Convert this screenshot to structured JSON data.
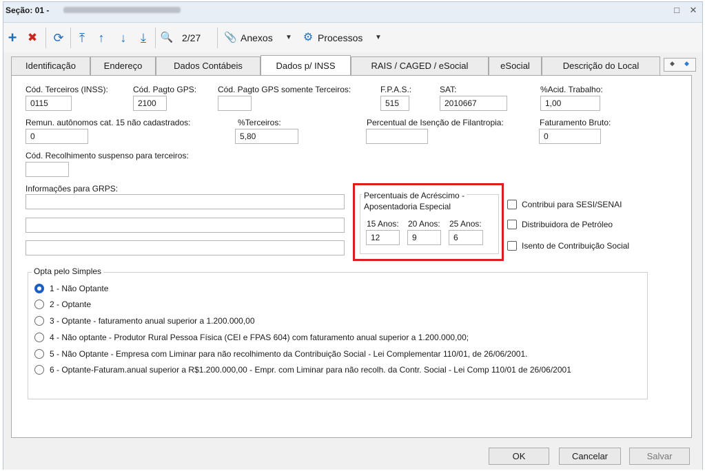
{
  "window": {
    "title": "Seção: 01 -",
    "maximize_icon": "□",
    "close_icon": "✕"
  },
  "toolbar": {
    "record_position": "2/27",
    "anexos_label": "Anexos",
    "processos_label": "Processos",
    "icons": {
      "add": "+",
      "delete": "✖",
      "refresh": "⟳",
      "first": "⤒",
      "up": "↑",
      "down": "↓",
      "last": "⤓",
      "search": "🔍",
      "attach": "📎",
      "gear": "⚙",
      "dropdown": "▼"
    },
    "colors": {
      "add": "#1f6fbf",
      "delete": "#c8281e",
      "nav": "#1f6fbf"
    }
  },
  "tabs": [
    {
      "label": "Identificação"
    },
    {
      "label": "Endereço"
    },
    {
      "label": "Dados Contábeis"
    },
    {
      "label": "Dados p/ INSS"
    },
    {
      "label": "RAIS / CAGED / eSocial"
    },
    {
      "label": "eSocial"
    },
    {
      "label": "Descrição do Local"
    }
  ],
  "active_tab": "Dados p/ INSS",
  "tab_nav": {
    "prev": "◆",
    "next": "◆"
  },
  "form": {
    "cod_terceiros": {
      "label": "Cód. Terceiros (INSS):",
      "value": "0115"
    },
    "cod_pagto_gps": {
      "label": "Cód. Pagto GPS:",
      "value": "2100"
    },
    "cod_pagto_gps_terceiros": {
      "label": "Cód. Pagto GPS somente Terceiros:",
      "value": ""
    },
    "fpas": {
      "label": "F.P.A.S.:",
      "value": "515"
    },
    "sat": {
      "label": "SAT:",
      "value": "2010667"
    },
    "acid_trabalho": {
      "label": "%Acid. Trabalho:",
      "value": "1,00"
    },
    "remun_autonomos": {
      "label": "Remun. autônomos cat. 15 não cadastrados:",
      "value": "0"
    },
    "terceiros": {
      "label": "%Terceiros:",
      "value": "5,80"
    },
    "isencao_filantropia": {
      "label": "Percentual de Isenção de Filantropia:",
      "value": ""
    },
    "faturamento_bruto": {
      "label": "Faturamento Bruto:",
      "value": "0"
    },
    "cod_recolhimento_suspenso": {
      "label": "Cód. Recolhimento suspenso para terceiros:",
      "value": ""
    },
    "info_grps": {
      "label": "Informações para GRPS:",
      "lines": [
        "",
        "",
        ""
      ]
    }
  },
  "acrescimo_group": {
    "title_line1": "Percentuais de Acréscimo -",
    "title_line2": "Aposentadoria Especial",
    "anos15": {
      "label": "15 Anos:",
      "value": "12"
    },
    "anos20": {
      "label": "20 Anos:",
      "value": "9"
    },
    "anos25": {
      "label": "25 Anos:",
      "value": "6"
    },
    "highlight_color": "#e01b1b"
  },
  "checkboxes": [
    {
      "label": "Contribui para SESI/SENAI",
      "checked": false
    },
    {
      "label": "Distribuidora de Petróleo",
      "checked": false
    },
    {
      "label": "Isento de Contribuição Social",
      "checked": false
    }
  ],
  "simples_group": {
    "title": "Opta pelo Simples",
    "options": [
      {
        "label": "1 - Não Optante",
        "selected": true
      },
      {
        "label": "2 - Optante",
        "selected": false
      },
      {
        "label": "3 - Optante - faturamento anual superior a 1.200.000,00",
        "selected": false
      },
      {
        "label": "4 - Não optante - Produtor Rural Pessoa Física (CEI e FPAS 604)  com faturamento anual superior a 1.200.000,00;",
        "selected": false
      },
      {
        "label": "5 - Não Optante - Empresa com Liminar para não recolhimento da Contribuição Social - Lei Complementar 110/01, de 26/06/2001.",
        "selected": false
      },
      {
        "label": "6 - Optante-Faturam.anual superior a R$1.200.000,00 - Empr. com Liminar para não recolh. da Contr. Social - Lei Comp 110/01 de 26/06/2001",
        "selected": false
      }
    ]
  },
  "footer": {
    "ok_label": "OK",
    "cancel_label": "Cancelar",
    "save_label": "Salvar"
  }
}
